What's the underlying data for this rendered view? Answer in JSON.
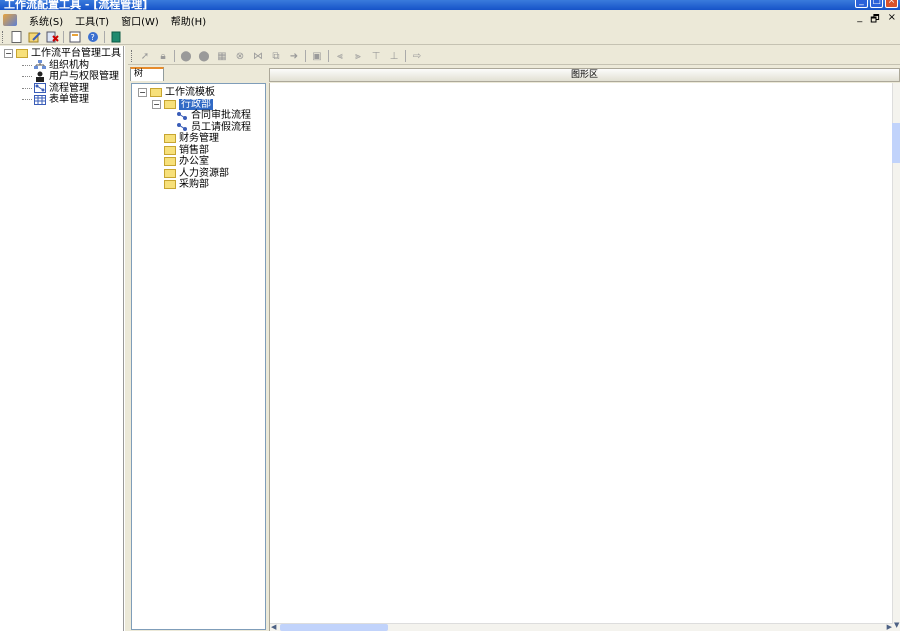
{
  "window": {
    "title": "工作流配置工具 - [流程管理]",
    "controls": [
      "minimize-icon",
      "maximize-icon",
      "close-icon"
    ]
  },
  "menu": {
    "items": [
      "系统(S)",
      "工具(T)",
      "窗口(W)",
      "帮助(H)"
    ],
    "mdi_controls": [
      "_",
      "🗗",
      "×"
    ]
  },
  "left_tree": {
    "root": "工作流平台管理工具",
    "children": [
      "组织机构",
      "用户与权限管理",
      "流程管理",
      "表单管理"
    ]
  },
  "tab": {
    "label": "树"
  },
  "mid_tree": {
    "root": "工作流模板",
    "selected_folder": "行政部",
    "selected_children": [
      "合同审批流程",
      "员工请假流程"
    ],
    "other_folders": [
      "财务管理",
      "销售部",
      "办公室",
      "人力资源部",
      "采购部"
    ]
  },
  "graph": {
    "header": "图形区"
  },
  "colors": {
    "title_bar": "#1653c8",
    "selection": "#316ac5",
    "tab_accent": "#e68b2c"
  }
}
